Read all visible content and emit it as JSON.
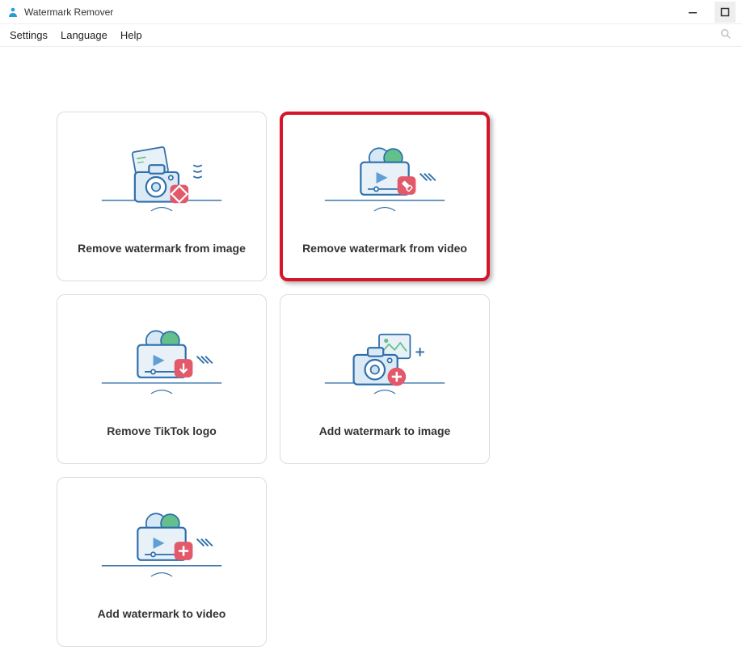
{
  "app_title": "Watermark Remover",
  "menu": {
    "settings": "Settings",
    "language": "Language",
    "help": "Help"
  },
  "cards": [
    {
      "label": "Remove watermark from image"
    },
    {
      "label": "Remove watermark from video"
    },
    {
      "label": "Remove TikTok logo"
    },
    {
      "label": "Add watermark to image"
    },
    {
      "label": "Add watermark to video"
    }
  ]
}
